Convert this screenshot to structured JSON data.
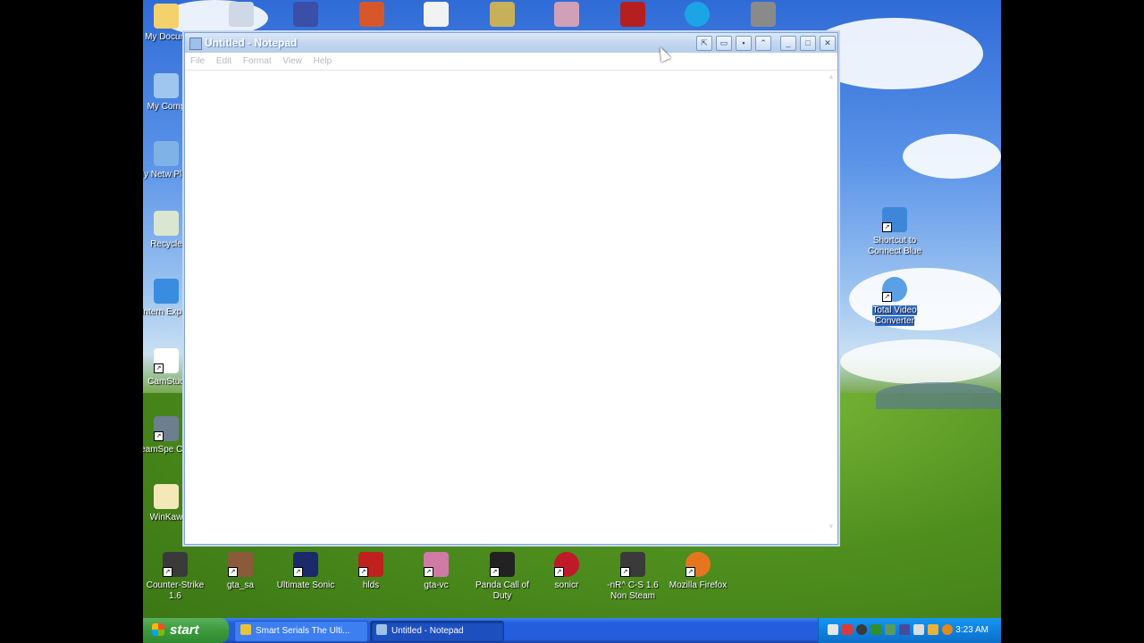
{
  "notepad": {
    "title": "Untitled - Notepad",
    "menu": [
      "File",
      "Edit",
      "Format",
      "View",
      "Help"
    ],
    "text": ""
  },
  "desktop_left": [
    {
      "label": "My Docum",
      "icon": "folder-icon",
      "color": "#f3d26b"
    },
    {
      "label": "My Comp",
      "icon": "computer-icon",
      "color": "#9fc6ee"
    },
    {
      "label": "My Netw Place",
      "icon": "network-icon",
      "color": "#7fb2e6"
    },
    {
      "label": "Recycle",
      "icon": "recycle-bin-icon",
      "color": "#d9e6d2"
    },
    {
      "label": "Intern Explor",
      "icon": "internet-explorer-icon",
      "color": "#3a8ce0"
    },
    {
      "label": "CamStud",
      "icon": "camstudio-icon",
      "color": "#ffffff"
    },
    {
      "label": "TeamSpe Clien",
      "icon": "teamspeak-icon",
      "color": "#6b7f8e"
    },
    {
      "label": "WinKaw",
      "icon": "winkawaks-icon",
      "color": "#f4e7b8"
    }
  ],
  "desktop_top": [
    {
      "icon": "app-icon-1",
      "color": "#cfd8e6"
    },
    {
      "icon": "app-icon-2",
      "color": "#3a4fa8"
    },
    {
      "icon": "app-icon-3",
      "color": "#d8572a"
    },
    {
      "icon": "app-icon-4",
      "color": "#f2f2f2"
    },
    {
      "icon": "app-icon-5",
      "color": "#c8b05a"
    },
    {
      "icon": "app-icon-6",
      "color": "#d0a0b8"
    },
    {
      "icon": "nc-buy-icon",
      "color": "#b51f1f"
    },
    {
      "icon": "skype-icon",
      "color": "#1ba4e6"
    },
    {
      "icon": "app-icon-9",
      "color": "#8a8a8a"
    }
  ],
  "desktop_right": [
    {
      "label": "Shortcut to Connect Blue",
      "icon": "connect-blue-icon",
      "color": "#3e86d8"
    },
    {
      "label": "Total Video Converter",
      "icon": "total-video-converter-icon",
      "color": "#5aa0e6",
      "selected": true
    }
  ],
  "desktop_bottom": [
    {
      "label": "Counter-Strike 1.6",
      "icon": "counter-strike-icon",
      "color": "#3a3a3a"
    },
    {
      "label": "gta_sa",
      "icon": "gta-sa-icon",
      "color": "#8a5a3a"
    },
    {
      "label": "Ultimate Sonic",
      "icon": "sonic-icon",
      "color": "#1a2a6a"
    },
    {
      "label": "hlds",
      "icon": "hlds-icon",
      "color": "#c0201e"
    },
    {
      "label": "gta-vc",
      "icon": "gta-vc-icon",
      "color": "#d07aa8"
    },
    {
      "label": "Panda Call of Duty",
      "icon": "panda-icon",
      "color": "#222222"
    },
    {
      "label": "sonicr",
      "icon": "sonicr-icon",
      "color": "#c01a2a"
    },
    {
      "label": "-nR^ C-S 1.6 Non Steam",
      "icon": "counter-strike-nonsteam-icon",
      "color": "#3a3a3a"
    },
    {
      "label": "Mozilla Firefox",
      "icon": "firefox-icon",
      "color": "#e5761f"
    }
  ],
  "taskbar": {
    "start_label": "start",
    "tasks": [
      {
        "label": "Smart Serials The Ulti...",
        "icon_color": "#e8c43a"
      },
      {
        "label": "Untitled - Notepad",
        "icon_color": "#9ec1ea"
      }
    ],
    "clock": "3:23 AM",
    "tray_colors": [
      "#e6e6e6",
      "#d83b3b",
      "#3a3a3a",
      "#2f8f2f",
      "#5a9a5a",
      "#4a4a9a",
      "#dddddd",
      "#eab23a",
      "#e08a1f"
    ]
  }
}
